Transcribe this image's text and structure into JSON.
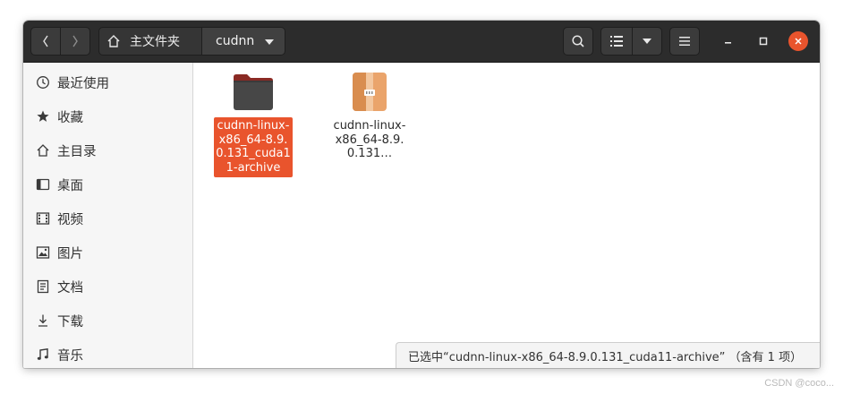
{
  "header": {
    "back_icon": "chevron-left-icon",
    "forward_icon": "chevron-right-icon",
    "path": {
      "home_label": "主文件夹",
      "current_label": "cudnn"
    },
    "search_icon": "search-icon",
    "view_icon": "list-view-icon",
    "view_menu_icon": "caret-down-icon",
    "menu_icon": "hamburger-menu-icon",
    "window_controls": [
      "minimize-icon",
      "maximize-icon",
      "close-icon"
    ]
  },
  "sidebar": {
    "items": [
      {
        "label": "最近使用",
        "icon": "clock-icon"
      },
      {
        "label": "收藏",
        "icon": "star-icon"
      },
      {
        "label": "主目录",
        "icon": "home-icon"
      },
      {
        "label": "桌面",
        "icon": "desktop-icon"
      },
      {
        "label": "视频",
        "icon": "video-icon"
      },
      {
        "label": "图片",
        "icon": "image-icon"
      },
      {
        "label": "文档",
        "icon": "document-icon"
      },
      {
        "label": "下载",
        "icon": "download-icon"
      },
      {
        "label": "音乐",
        "icon": "music-icon"
      }
    ]
  },
  "files": [
    {
      "name": "cudnn-linux-x86_64-8.9.0.131_cuda11-archive",
      "type": "folder",
      "selected": true
    },
    {
      "name": "cudnn-linux-x86_64-8.9.0.131…",
      "type": "archive",
      "selected": false
    }
  ],
  "status": {
    "text": "已选中“cudnn-linux-x86_64-8.9.0.131_cuda11-archive” （含有 1 项）"
  },
  "watermark": "CSDN @coco...",
  "colors": {
    "accent": "#e9542d",
    "headerbar": "#2c2c2c",
    "sidebar": "#f6f6f6"
  }
}
